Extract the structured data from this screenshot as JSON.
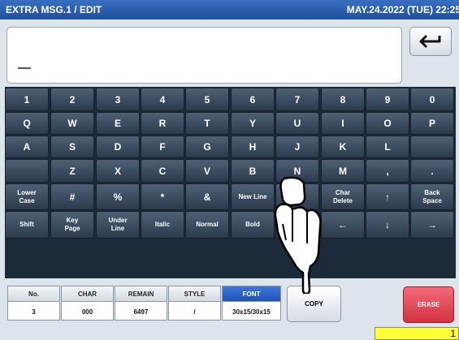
{
  "header": {
    "title": "EXTRA MSG.1 / EDIT",
    "datetime": "MAY.24.2022 (TUE) 22:25"
  },
  "editor": {
    "text": ""
  },
  "enter_icon": "return-arrow-icon",
  "keys": [
    [
      "1",
      "2",
      "3",
      "4",
      "5",
      "6",
      "7",
      "8",
      "9",
      "0"
    ],
    [
      "Q",
      "W",
      "E",
      "R",
      "T",
      "Y",
      "U",
      "I",
      "O",
      "P"
    ],
    [
      "A",
      "S",
      "D",
      "F",
      "G",
      "H",
      "J",
      "K",
      "L",
      ""
    ],
    [
      "",
      "Z",
      "X",
      "C",
      "V",
      "B",
      "N",
      "M",
      ",",
      "."
    ],
    [
      "Lower\nCase",
      "#",
      "%",
      "*",
      "&",
      "New Line",
      "",
      "Char\nDelete",
      "↑",
      "Back\nSpace"
    ],
    [
      "Shift",
      "Key\nPage",
      "Under\nLine",
      "Italic",
      "Normal",
      "Bold",
      "",
      "←",
      "↓",
      "→"
    ]
  ],
  "status": {
    "no": {
      "label": "No.",
      "value": "3"
    },
    "char": {
      "label": "CHAR",
      "value": "000"
    },
    "remain": {
      "label": "REMAIN",
      "value": "6497"
    },
    "style": {
      "label": "STYLE",
      "value": "/"
    },
    "font": {
      "label": "FONT",
      "value": "30x15/30x15"
    }
  },
  "buttons": {
    "copy": "COPY",
    "erase": "ERASE"
  },
  "counter": "1",
  "colors": {
    "title_bar": "#2a5eb0",
    "keyboard_bg": "#1c2a3a",
    "key": "#3e4d61",
    "erase": "#e04452",
    "font_header": "#2a64c8",
    "counter_bg": "#ffff33"
  }
}
